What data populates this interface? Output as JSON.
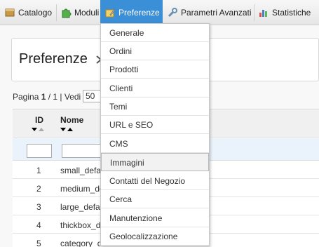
{
  "menubar": {
    "items": [
      {
        "label": "Catalogo",
        "icon": "catalog-icon"
      },
      {
        "label": "Moduli",
        "icon": "puzzle-icon"
      },
      {
        "label": "Preferenze",
        "icon": "preferences-icon",
        "active": true
      },
      {
        "label": "Parametri Avanzati",
        "icon": "wrench-icon"
      },
      {
        "label": "Statistiche",
        "icon": "chart-icon"
      }
    ]
  },
  "page": {
    "title": "Preferenze"
  },
  "pager": {
    "pagina_label": "Pagina ",
    "page": "1",
    "separator": " / 1 | Vedi",
    "per_page": "50"
  },
  "table": {
    "headers": {
      "id": "ID",
      "name": "Nome"
    },
    "rows": [
      {
        "id": "1",
        "name": "small_defa"
      },
      {
        "id": "2",
        "name": "medium_de"
      },
      {
        "id": "3",
        "name": "large_defa"
      },
      {
        "id": "4",
        "name": "thickbox_d"
      },
      {
        "id": "5",
        "name": "category_d"
      }
    ]
  },
  "dropdown": {
    "items": [
      "Generale",
      "Ordini",
      "Prodotti",
      "Clienti",
      "Temi",
      "URL e SEO",
      "CMS",
      "Immagini",
      "Contatti del Negozio",
      "Cerca",
      "Manutenzione",
      "Geolocalizzazione"
    ],
    "hovered": "Immagini"
  },
  "colors": {
    "active_menu": "#3a8fd6"
  }
}
